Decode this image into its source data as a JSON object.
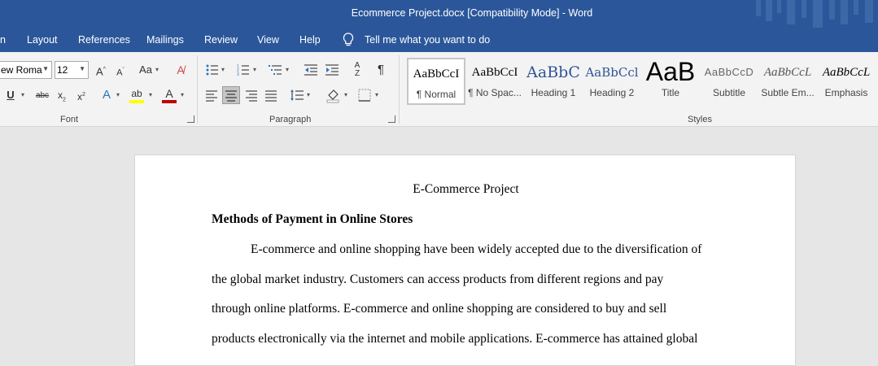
{
  "window": {
    "title": "Ecommerce Project.docx [Compatibility Mode]  -  Word"
  },
  "tabs": [
    "n",
    "Layout",
    "References",
    "Mailings",
    "Review",
    "View",
    "Help"
  ],
  "tell_me": {
    "label": "Tell me what you want to do",
    "icon": "lightbulb-icon"
  },
  "font": {
    "name": "ew Roma",
    "size": "12",
    "group_label": "Font"
  },
  "paragraph": {
    "group_label": "Paragraph"
  },
  "styles": {
    "group_label": "Styles",
    "items": [
      {
        "preview": "AaBbCcI",
        "name": "¶ Normal"
      },
      {
        "preview": "AaBbCcI",
        "name": "¶ No Spac..."
      },
      {
        "preview": "AaBbC",
        "name": "Heading 1"
      },
      {
        "preview": "AaBbCcl",
        "name": "Heading 2"
      },
      {
        "preview": "AaB",
        "name": "Title"
      },
      {
        "preview": "AaBbCcD",
        "name": "Subtitle"
      },
      {
        "preview": "AaBbCcL",
        "name": "Subtle Em..."
      },
      {
        "preview": "AaBbCcL",
        "name": "Emphasis"
      }
    ]
  },
  "document": {
    "title": "E-Commerce Project",
    "heading": "Methods of Payment in Online Stores",
    "lines": [
      "E-commerce and online shopping have been widely accepted due to the diversification of",
      "the global market industry. Customers can access products from different regions and pay",
      "through online platforms. E-commerce and online shopping are considered to buy and sell",
      "products electronically via the internet and mobile applications. E-commerce has attained global"
    ]
  },
  "colors": {
    "accent": "#2b579a",
    "ribbon": "#f3f3f3",
    "canvas": "#e6e6e6"
  }
}
